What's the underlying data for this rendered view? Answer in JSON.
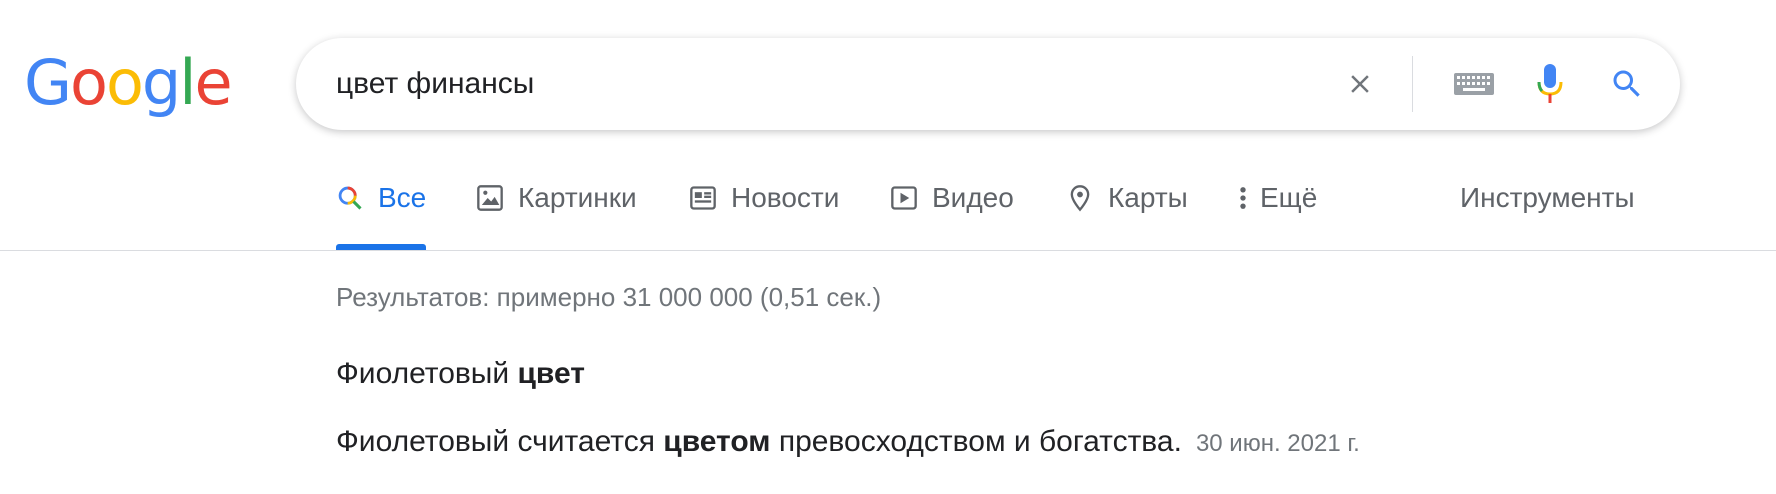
{
  "logo": {
    "letters": [
      "G",
      "o",
      "o",
      "g",
      "l",
      "e"
    ],
    "colors": [
      "#4285F4",
      "#EA4335",
      "#FBBC05",
      "#4285F4",
      "#34A853",
      "#EA4335"
    ]
  },
  "search": {
    "value": "цвет финансы",
    "placeholder": ""
  },
  "search_actions": {
    "clear_icon": "close-icon",
    "keyboard_icon": "keyboard-icon",
    "mic_icon": "mic-icon",
    "search_icon": "search-icon"
  },
  "tabs": [
    {
      "label": "Все",
      "icon": "search-icon",
      "active": true
    },
    {
      "label": "Картинки",
      "icon": "image-icon",
      "active": false
    },
    {
      "label": "Новости",
      "icon": "news-icon",
      "active": false
    },
    {
      "label": "Видео",
      "icon": "play-icon",
      "active": false
    },
    {
      "label": "Карты",
      "icon": "map-pin-icon",
      "active": false
    },
    {
      "label": "Ещё",
      "icon": "more-vert-icon",
      "active": false
    }
  ],
  "tools_label": "Инструменты",
  "stats": "Результатов: примерно 31 000 000 (0,51 сек.)",
  "result": {
    "title_plain": "Фиолетовый ",
    "title_bold": "цвет",
    "snippet_before": "Фиолетовый считается ",
    "snippet_bold": "цветом",
    "snippet_after": " превосходством и богатства.",
    "date": "30 июн. 2021 г."
  },
  "colors": {
    "accent": "#1a73e8",
    "text": "#202124",
    "secondary": "#5f6368"
  }
}
